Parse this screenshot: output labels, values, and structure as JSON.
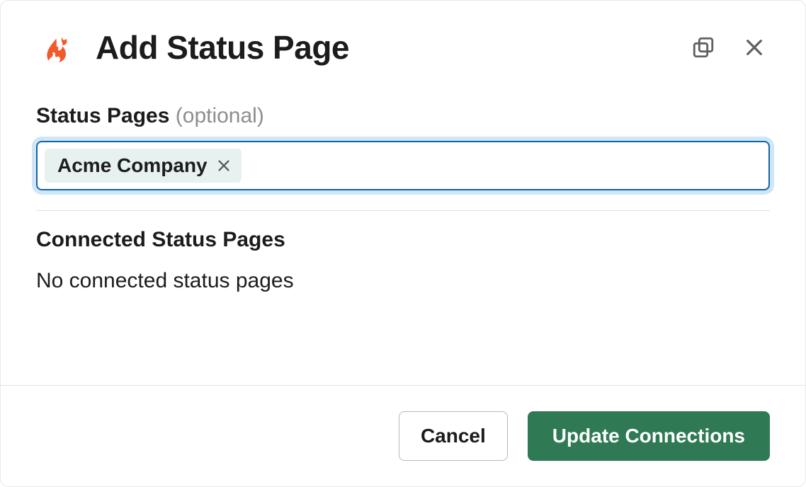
{
  "header": {
    "title": "Add Status Page",
    "icons": {
      "window": "window-stack-icon",
      "close": "close-icon"
    },
    "logo": "firehydrant-logo"
  },
  "form": {
    "status_pages": {
      "label": "Status Pages",
      "optional_text": "(optional)",
      "tokens": [
        {
          "label": "Acme Company"
        }
      ]
    }
  },
  "connected": {
    "heading": "Connected Status Pages",
    "empty_text": "No connected status pages"
  },
  "footer": {
    "cancel": "Cancel",
    "submit": "Update Connections"
  },
  "colors": {
    "accent": "#1264a3",
    "focus_ring": "#cfe6f7",
    "primary_btn": "#2f7a55",
    "logo": "#f15a29",
    "token_bg": "#e6f1f0"
  }
}
